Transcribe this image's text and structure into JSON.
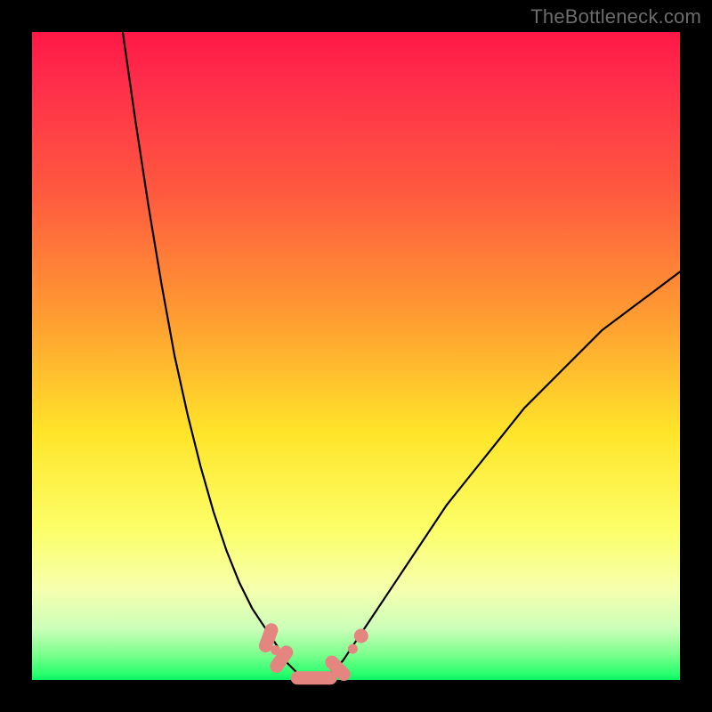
{
  "watermark": "TheBottleneck.com",
  "chart_data": {
    "type": "line",
    "title": "",
    "xlabel": "",
    "ylabel": "",
    "xlim": [
      0,
      100
    ],
    "ylim": [
      0,
      100
    ],
    "series": [
      {
        "name": "left-curve",
        "x": [
          14,
          16,
          18,
          20,
          22,
          24,
          26,
          28,
          30,
          32,
          34,
          36,
          38,
          39
        ],
        "values": [
          100,
          86,
          73,
          61,
          50,
          41,
          33,
          26,
          20,
          15,
          11,
          8,
          5,
          3
        ]
      },
      {
        "name": "valley-floor",
        "x": [
          39,
          40,
          41,
          42,
          43,
          44,
          45,
          46,
          47,
          48
        ],
        "values": [
          3,
          2,
          1,
          0,
          0,
          0,
          0,
          1,
          2,
          3
        ]
      },
      {
        "name": "right-curve",
        "x": [
          48,
          52,
          56,
          60,
          64,
          68,
          72,
          76,
          80,
          84,
          88,
          92,
          96,
          100
        ],
        "values": [
          3,
          9,
          15,
          21,
          27,
          32,
          37,
          42,
          46,
          50,
          54,
          57,
          60,
          63
        ]
      }
    ],
    "markers": [
      {
        "name": "left-pill-upper",
        "x": 36.5,
        "y": 6.5,
        "shape": "pill",
        "angle": 70
      },
      {
        "name": "left-pill-lower",
        "x": 38.5,
        "y": 3.2,
        "shape": "pill",
        "angle": 55
      },
      {
        "name": "left-tiny-dot",
        "x": 37.6,
        "y": 4.6,
        "shape": "dot"
      },
      {
        "name": "bottom-pill",
        "x": 43.5,
        "y": 0.3,
        "shape": "pill-horizontal"
      },
      {
        "name": "elbow-pill",
        "x": 47.2,
        "y": 1.8,
        "shape": "pill",
        "angle": -45
      },
      {
        "name": "right-dot-small",
        "x": 49.5,
        "y": 4.8,
        "shape": "dot"
      },
      {
        "name": "right-dot-large",
        "x": 50.8,
        "y": 6.8,
        "shape": "dot-large"
      }
    ],
    "background_gradient": {
      "stops": [
        {
          "pos": 0,
          "color": "#ff1846"
        },
        {
          "pos": 25,
          "color": "#ff5a3f"
        },
        {
          "pos": 62,
          "color": "#ffe52a"
        },
        {
          "pos": 92,
          "color": "#ccffb9"
        },
        {
          "pos": 100,
          "color": "#0cf264"
        }
      ]
    }
  }
}
